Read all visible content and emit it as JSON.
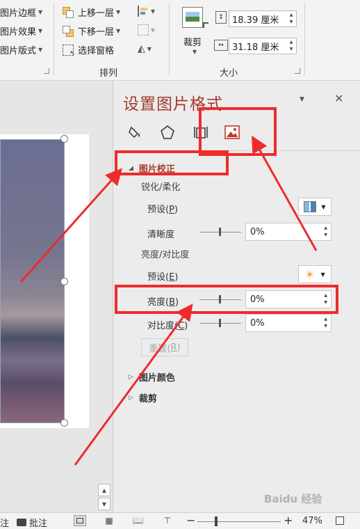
{
  "ribbon": {
    "group1": {
      "items": [
        "图片边框",
        "图片效果",
        "图片版式"
      ]
    },
    "arrange": {
      "bring_forward": "上移一层",
      "send_backward": "下移一层",
      "selection_pane": "选择窗格",
      "label": "排列"
    },
    "size": {
      "crop_label": "裁剪",
      "height_value": "18.39 厘米",
      "width_value": "31.18 厘米",
      "label": "大小"
    }
  },
  "pane": {
    "title": "设置图片格式",
    "tabs": [
      "fill-line-icon",
      "effects-pentagon-icon",
      "size-properties-icon",
      "picture-icon"
    ],
    "correction": {
      "header": "图片校正",
      "sharpen_header": "锐化/柔化",
      "sharpen_preset_label": "预设(",
      "sharpen_preset_key": "P",
      "clarity_label": "清晰度",
      "clarity_value": "0%",
      "bc_header": "亮度/对比度",
      "bc_preset_label": "预设(",
      "bc_preset_key": "E",
      "brightness_label": "亮度(",
      "brightness_key": "B",
      "brightness_value": "0%",
      "contrast_label": "对比度(",
      "contrast_key": "C",
      "contrast_value": "0%",
      "reset_label": "重置(",
      "reset_key": "R"
    },
    "picture_color": "图片颜色",
    "crop": "裁剪",
    "close_symbol": "✕",
    "menu_symbol": "▼"
  },
  "statusbar": {
    "notes": "注",
    "comments": "批注",
    "zoom_minus": "−",
    "zoom_plus": "+",
    "zoom_value": "47%"
  },
  "watermark": "Baidu 经验",
  "colors": {
    "accent": "#a33a2e",
    "annotation": "#ee2b2b",
    "pane_bg": "#ececec"
  }
}
